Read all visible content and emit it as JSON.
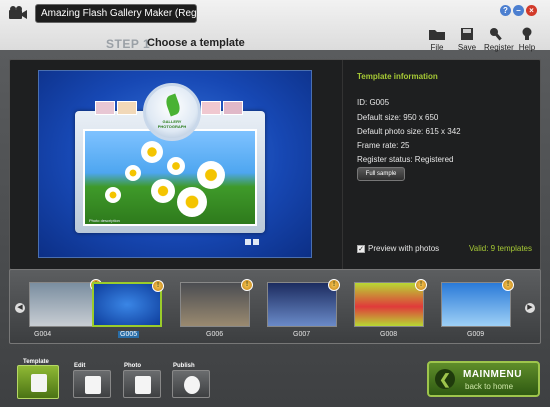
{
  "window": {
    "title": "Amazing Flash Gallery Maker (Registered)"
  },
  "toolbar": {
    "step": "STEP 1",
    "step_title": "Choose a template",
    "buttons": [
      {
        "label": "File",
        "icon": "folder-icon"
      },
      {
        "label": "Save",
        "icon": "save-icon"
      },
      {
        "label": "Register",
        "icon": "key-icon"
      },
      {
        "label": "Help",
        "icon": "lightbulb-icon"
      }
    ]
  },
  "preview": {
    "badge_line1": "GALLERY",
    "badge_line2": "PHOTOGRAPH",
    "caption": "Photo description"
  },
  "info": {
    "title": "Template information",
    "id": "ID: G005",
    "default_size": "Default size: 950 x 650",
    "photo_size": "Default photo size: 615 x 342",
    "frame_rate": "Frame rate: 25",
    "register_status": "Register status: Registered",
    "full_sample": "Full sample",
    "preview_with_photos": "Preview with photos",
    "preview_checked": true,
    "valid": "Valid: 9 templates"
  },
  "templates": [
    {
      "name": "G004",
      "selected": false,
      "locked": true
    },
    {
      "name": "G005",
      "selected": true,
      "locked": true
    },
    {
      "name": "G006",
      "selected": false,
      "locked": true
    },
    {
      "name": "G007",
      "selected": false,
      "locked": true
    },
    {
      "name": "G008",
      "selected": false,
      "locked": true
    },
    {
      "name": "G009",
      "selected": false,
      "locked": true
    }
  ],
  "nav": {
    "template": "Template",
    "edit": "Edit",
    "photo": "Photo",
    "publish": "Publish",
    "mainmenu": "MAINMENU",
    "back": "back to home"
  },
  "colors": {
    "accent_green": "#a6c935",
    "selection_border": "#9bcc2a",
    "panel_bg": "#1e1f20"
  }
}
